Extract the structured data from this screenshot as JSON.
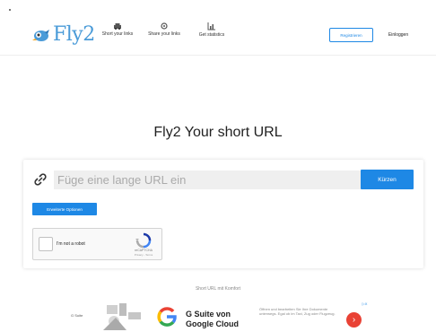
{
  "header": {
    "logo_text": "Fly2",
    "nav": [
      {
        "label": "Short your links",
        "icon": "car-icon"
      },
      {
        "label": "Share your links",
        "icon": "share-icon"
      },
      {
        "label": "Get statistics",
        "icon": "chart-icon"
      }
    ],
    "register_label": "Registrieren",
    "login_label": "Einloggen"
  },
  "main": {
    "title": "Fly2 Your short URL",
    "url_placeholder": "Füge eine lange URL ein",
    "shorten_label": "Kürzen",
    "options_label": "Erweiterte Optionen",
    "captcha_label": "I'm not a robot",
    "captcha_brand": "reCAPTCHA",
    "captcha_terms": "Privacy - Terms",
    "footer_note": "Short URL mit Komfort"
  },
  "ad": {
    "brand_small": "G Suite",
    "headline": "G Suite von Google Cloud",
    "body": "Öffnen und bearbeiten Sie Ihre Dokumente unterwegs. Egal ob im Taxi, Zug oder Flugzeug.",
    "cta": "›",
    "badge": "▷X"
  },
  "colors": {
    "accent": "#1e88e5",
    "logo": "#4a9bd8",
    "ad_cta": "#e94235"
  }
}
